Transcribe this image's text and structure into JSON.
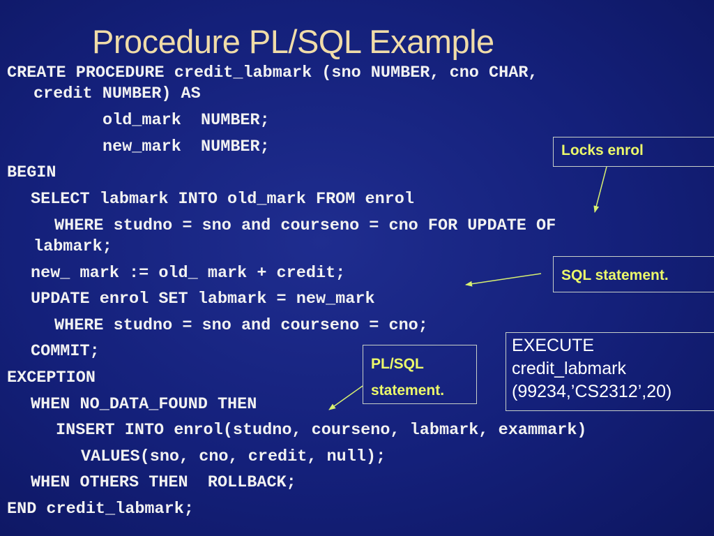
{
  "slide": {
    "title": "Procedure PL/SQL Example",
    "code_lines": [
      "CREATE PROCEDURE credit_labmark (sno NUMBER, cno CHAR,",
      "credit NUMBER) AS",
      "old_mark  NUMBER;",
      "new_mark  NUMBER;",
      "BEGIN",
      "SELECT labmark INTO old_mark FROM enrol",
      "WHERE studno = sno and courseno = cno FOR UPDATE OF",
      "labmark;",
      "new_ mark := old_ mark + credit;",
      "UPDATE enrol SET labmark = new_mark",
      "WHERE studno = sno and courseno = cno;",
      "COMMIT;",
      "EXCEPTION",
      "WHEN NO_DATA_FOUND THEN",
      "INSERT INTO enrol(studno, courseno, labmark, exammark)",
      "VALUES(sno, cno, credit, null);",
      "WHEN OTHERS THEN  ROLLBACK;",
      "END credit_labmark;"
    ],
    "callouts": {
      "locks": "Locks enrol",
      "sql_statement": "SQL statement.",
      "plsql_line1": "PL/SQL",
      "plsql_line2": "statement."
    },
    "execute_box": {
      "line1": "EXECUTE",
      "line2": "credit_labmark",
      "line3": "(99234,’CS2312’,20)"
    },
    "colors": {
      "background": "#14207a",
      "title": "#f0dca8",
      "code": "#f2f2f2",
      "callout_text": "#ecf96a",
      "arrow": "#d8f070"
    }
  }
}
